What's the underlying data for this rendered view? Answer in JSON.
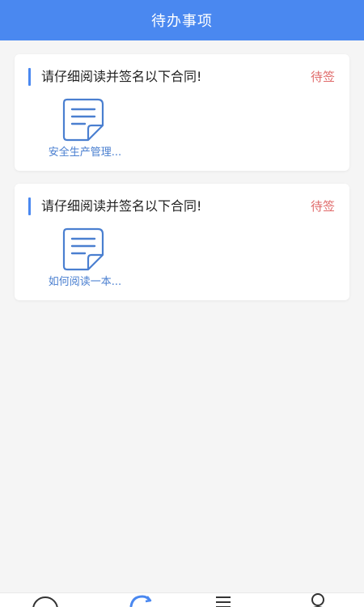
{
  "header": {
    "title": "待办事项"
  },
  "tasks": [
    {
      "title": "请仔细阅读并签名以下合同!",
      "status": "待签",
      "document": "安全生产管理..."
    },
    {
      "title": "请仔细阅读并签名以下合同!",
      "status": "待签",
      "document": "如何阅读一本..."
    }
  ],
  "tabbar": {
    "icons": [
      "chat-icon",
      "sync-icon",
      "list-icon",
      "profile-icon"
    ],
    "active_icon": "sync-icon"
  },
  "colors": {
    "accent": "#4a88f0",
    "status": "#e06a6a",
    "doc_link": "#4a7fd0",
    "background": "#f5f5f5"
  }
}
